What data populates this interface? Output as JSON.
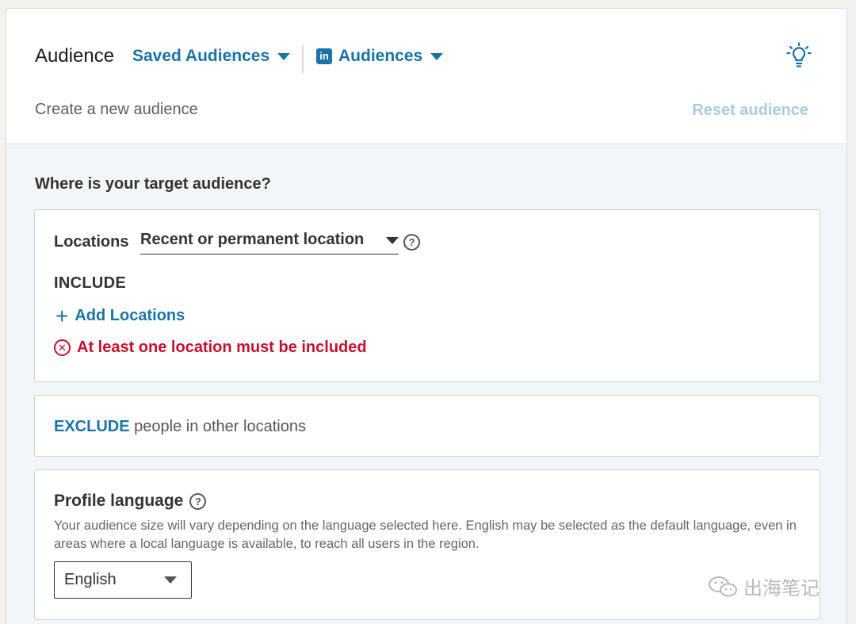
{
  "header": {
    "title": "Audience",
    "saved_audiences_label": "Saved Audiences",
    "linkedin_logo_text": "in",
    "linkedin_audiences_label": "Audiences",
    "subtitle": "Create a new audience",
    "reset_label": "Reset audience"
  },
  "targeting": {
    "question": "Where is your target audience?",
    "locations": {
      "label": "Locations",
      "type_selected": "Recent or permanent location",
      "include_label": "INCLUDE",
      "add_label": "Add Locations",
      "error_text": "At least one location must be included"
    },
    "exclude": {
      "link_label": "EXCLUDE",
      "text": "people in other locations"
    },
    "profile_language": {
      "title": "Profile language",
      "description": "Your audience size will vary depending on the language selected here. English may be selected as the default language, even in areas where a local language is available, to reach all users in the region.",
      "selected": "English"
    }
  },
  "watermark": {
    "text": "出海笔记"
  },
  "icons": {
    "bulb": "lightbulb-icon",
    "help": "help-circle-icon",
    "error": "error-circle-icon",
    "plus": "plus-icon",
    "caret": "caret-down-icon"
  },
  "colors": {
    "link": "#1a73a8",
    "error": "#c8102e",
    "reset_disabled": "#a9cbe0"
  }
}
